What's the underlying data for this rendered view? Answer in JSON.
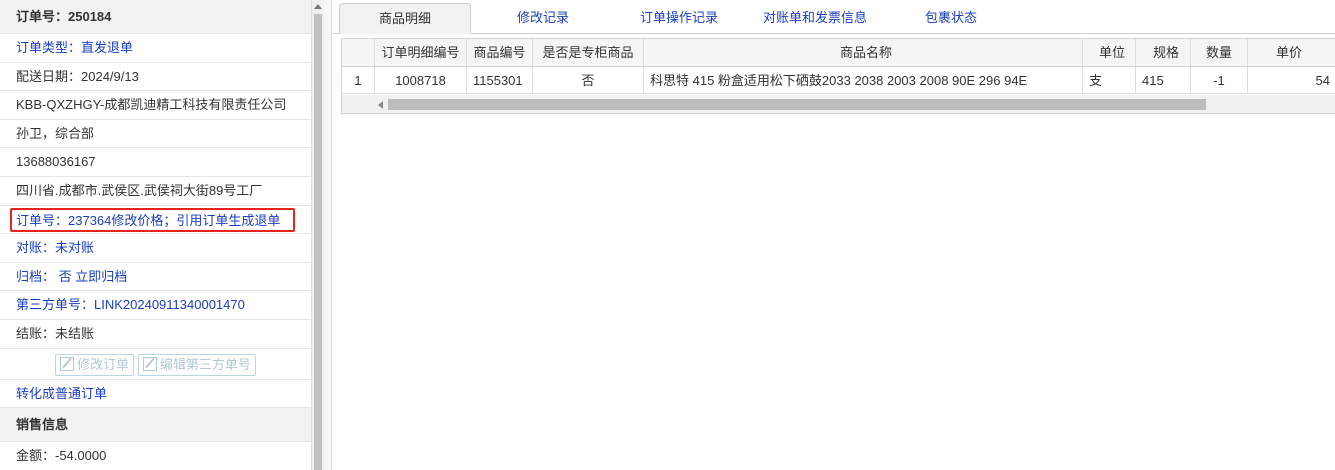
{
  "order_panel": {
    "header": "订单号：250184",
    "order_type": "订单类型：直发退单",
    "delivery_date": "配送日期：2024/9/13",
    "company": "KBB-QXZHGY-成都凯迪精工科技有限责任公司",
    "contact": "孙卫，综合部",
    "phone": "13688036167",
    "address": "四川省.成都市.武侯区.武侯祠大街89号工厂",
    "note": "订单号：237364修改价格；引用订单生成退单",
    "reconcile": "对账：未对账",
    "archive": "归档： 否 立即归档",
    "third_party": "第三方单号：LINK20240911340001470",
    "settle": "结账：未结账",
    "btn_edit_order": "修改订单",
    "btn_edit_third": "编辑第三方单号",
    "convert": "转化成普通订单",
    "sales_header": "销售信息",
    "amount": "金额：-54.0000"
  },
  "tabs": [
    {
      "label": "商品明细"
    },
    {
      "label": "修改记录"
    },
    {
      "label": "订单操作记录"
    },
    {
      "label": "对账单和发票信息"
    },
    {
      "label": "包裹状态"
    }
  ],
  "grid": {
    "columns": [
      "订单明细编号",
      "商品编号",
      "是否是专柜商品",
      "商品名称",
      "单位",
      "规格",
      "数量",
      "单价"
    ],
    "rows": [
      {
        "index": "1",
        "detail_id": "1008718",
        "product_id": "1155301",
        "counter": "否",
        "name": "科思特 415 粉盒适用松下硒鼓2033 2038 2003 2008 90E 296 94E",
        "unit": "支",
        "spec": "415",
        "qty": "-1",
        "price": "54"
      }
    ]
  },
  "colors": {
    "link": "#1a3fbf",
    "highlight_border": "#e5241c"
  }
}
